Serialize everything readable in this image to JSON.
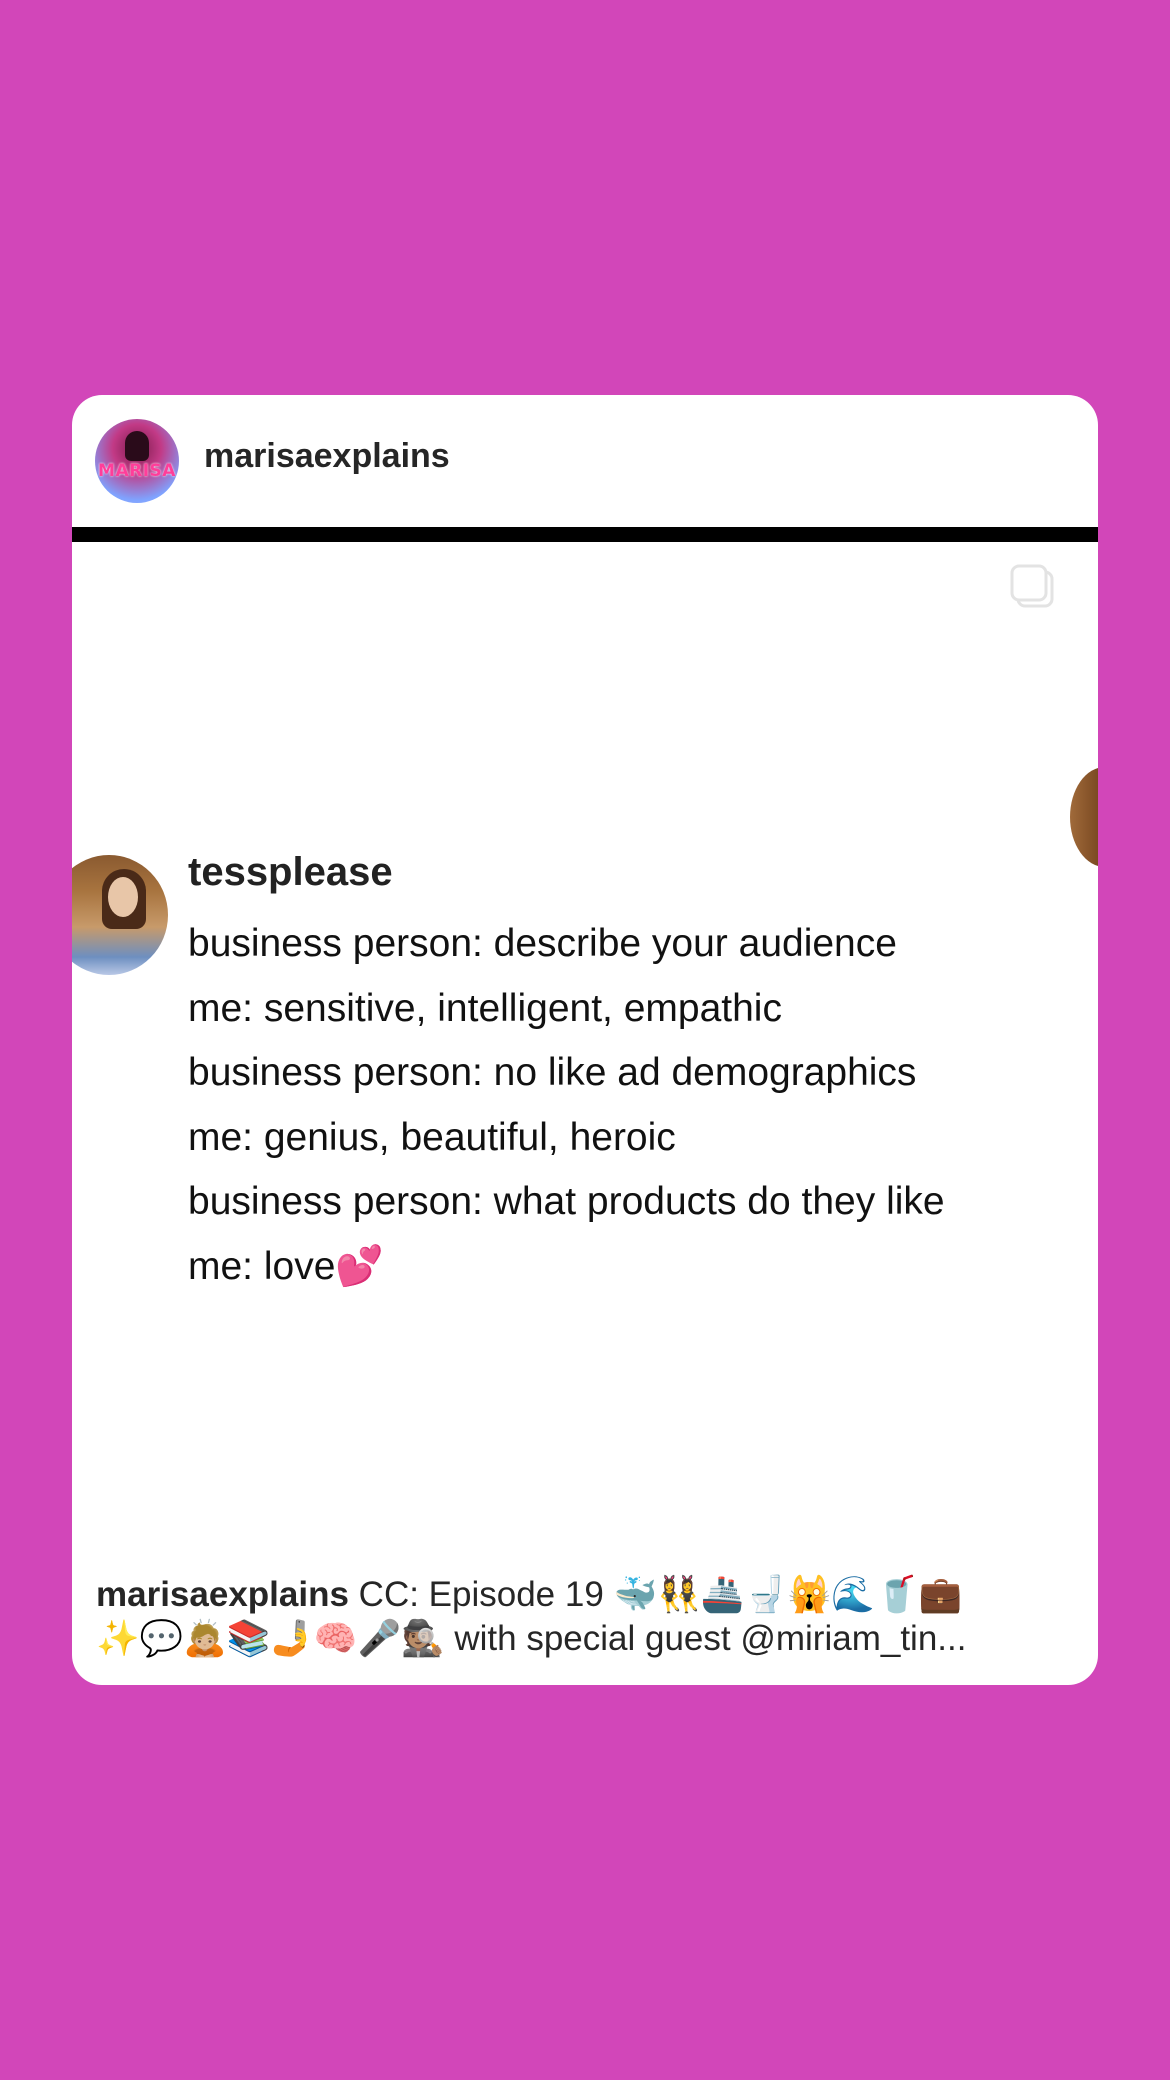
{
  "post": {
    "username": "marisaexplains",
    "avatar_logo_text": "MARISA",
    "tweet": {
      "author": "tessplease",
      "lines": [
        "business person: describe your audience",
        "me: sensitive, intelligent, empathic",
        "business person: no like ad demographics",
        "me: genius, beautiful, heroic",
        "business person: what products do they like",
        "me: love💕"
      ]
    },
    "caption": {
      "user": "marisaexplains",
      "text_line1": " CC: Episode 19 🐳👯‍♀️🚢🚽🙀🌊🥤💼",
      "text_line2": "✨💬🙇🏼📚🤳🧠🎤🕵🏽 with special guest @miriam_tin..."
    }
  },
  "colors": {
    "background": "#d246b9",
    "card": "#ffffff",
    "text": "#262626"
  },
  "icons": {
    "carousel": "multiple-posts-icon"
  }
}
